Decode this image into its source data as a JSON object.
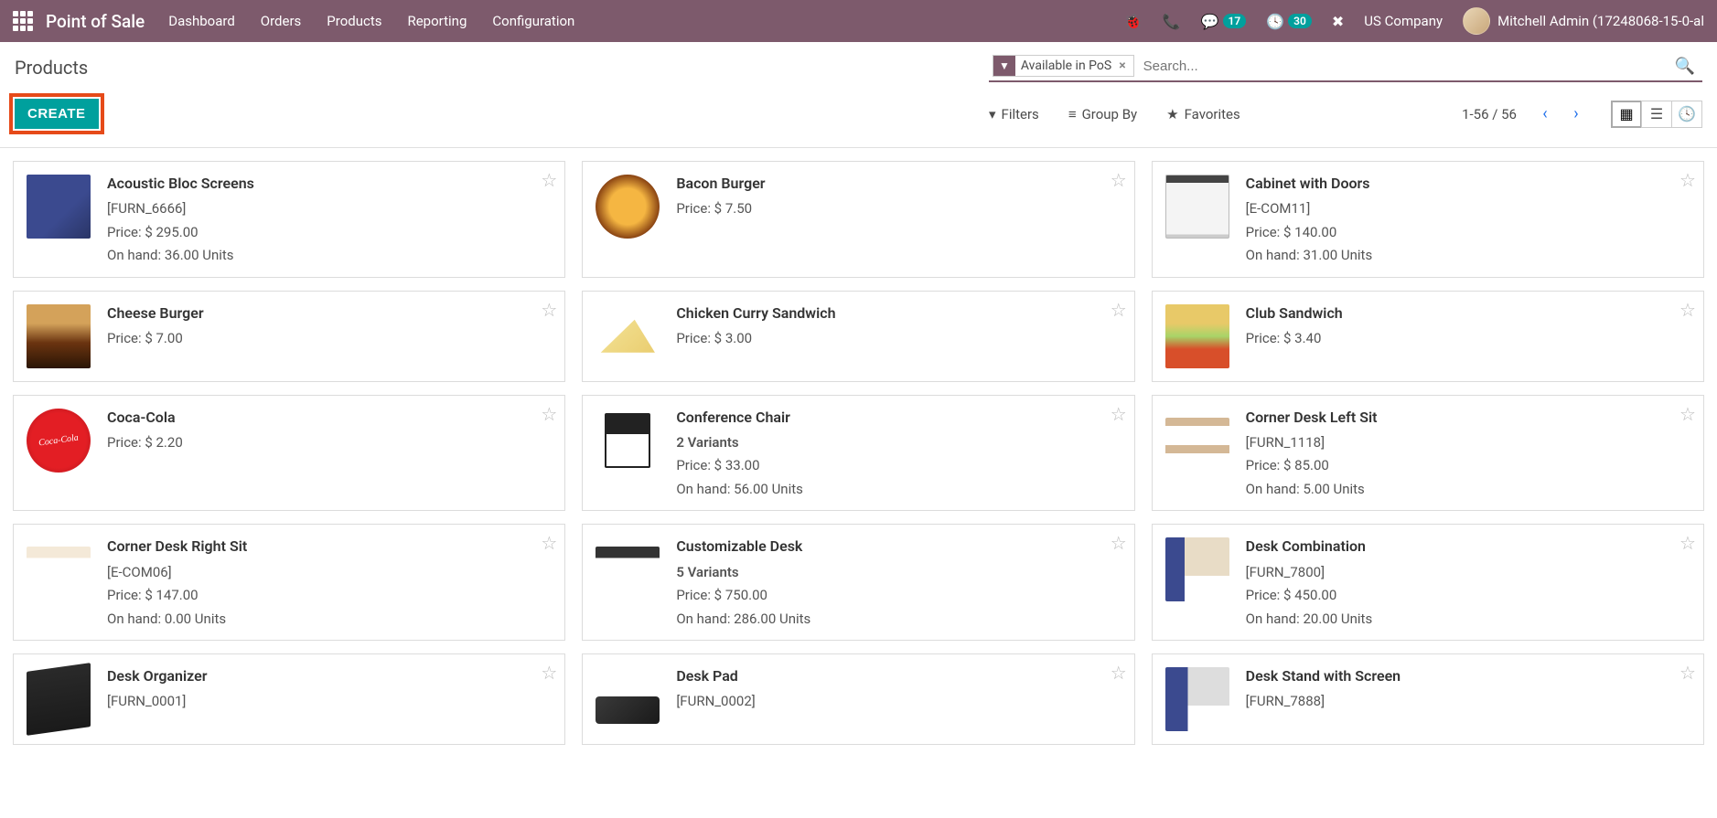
{
  "header": {
    "brand": "Point of Sale",
    "menu": [
      "Dashboard",
      "Orders",
      "Products",
      "Reporting",
      "Configuration"
    ],
    "msg_badge": "17",
    "act_badge": "30",
    "company": "US Company",
    "user": "Mitchell Admin (17248068-15-0-al"
  },
  "page": {
    "title": "Products",
    "create_label": "CREATE",
    "search_facet": "Available in PoS",
    "search_placeholder": "Search...",
    "filters_label": "Filters",
    "groupby_label": "Group By",
    "favorites_label": "Favorites",
    "pager": "1-56 / 56"
  },
  "labels": {
    "price_prefix": "Price: ",
    "onhand_prefix": "On hand: ",
    "units_suffix": " Units",
    "variants_suffix": " Variants"
  },
  "products": [
    {
      "name": "Acoustic Bloc Screens",
      "code": "[FURN_6666]",
      "price": "$ 295.00",
      "onhand": "36.00",
      "thumb": "t-blue"
    },
    {
      "name": "Bacon Burger",
      "price": "$ 7.50",
      "thumb": "t-burger"
    },
    {
      "name": "Cabinet with Doors",
      "code": "[E-COM11]",
      "price": "$ 140.00",
      "onhand": "31.00",
      "thumb": "t-cabinet"
    },
    {
      "name": "Cheese Burger",
      "price": "$ 7.00",
      "thumb": "t-burger2"
    },
    {
      "name": "Chicken Curry Sandwich",
      "price": "$ 3.00",
      "thumb": "t-sandwich"
    },
    {
      "name": "Club Sandwich",
      "price": "$ 3.40",
      "thumb": "t-club"
    },
    {
      "name": "Coca-Cola",
      "price": "$ 2.20",
      "thumb": "t-cola"
    },
    {
      "name": "Conference Chair",
      "variants": "2",
      "price": "$ 33.00",
      "onhand": "56.00",
      "thumb": "t-chair"
    },
    {
      "name": "Corner Desk Left Sit",
      "code": "[FURN_1118]",
      "price": "$ 85.00",
      "onhand": "5.00",
      "thumb": "t-desk1"
    },
    {
      "name": "Corner Desk Right Sit",
      "code": "[E-COM06]",
      "price": "$ 147.00",
      "onhand": "0.00",
      "thumb": "t-desk2"
    },
    {
      "name": "Customizable Desk",
      "variants": "5",
      "price": "$ 750.00",
      "onhand": "286.00",
      "thumb": "t-desk3"
    },
    {
      "name": "Desk Combination",
      "code": "[FURN_7800]",
      "price": "$ 450.00",
      "onhand": "20.00",
      "thumb": "t-combo"
    },
    {
      "name": "Desk Organizer",
      "code": "[FURN_0001]",
      "thumb": "t-org"
    },
    {
      "name": "Desk Pad",
      "code": "[FURN_0002]",
      "thumb": "t-pad"
    },
    {
      "name": "Desk Stand with Screen",
      "code": "[FURN_7888]",
      "thumb": "t-stand"
    }
  ]
}
